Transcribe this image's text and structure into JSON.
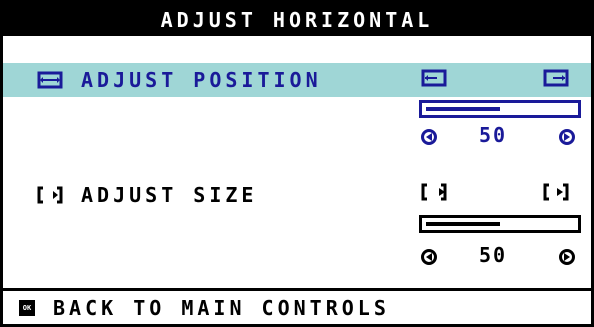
{
  "title": "ADJUST HORIZONTAL",
  "position": {
    "label": "ADJUST POSITION",
    "value": "50",
    "level": 0.5,
    "icon": "horizontal-position-icon",
    "color": "#1a1a99",
    "highlight_color": "#9fd6d6"
  },
  "size": {
    "label": "ADJUST SIZE",
    "value": "50",
    "level": 0.5,
    "icon": "horizontal-size-icon",
    "color": "#000000"
  },
  "footer": {
    "label": "BACK TO MAIN CONTROLS",
    "icon": "ok-icon",
    "icon_text": "OK"
  }
}
